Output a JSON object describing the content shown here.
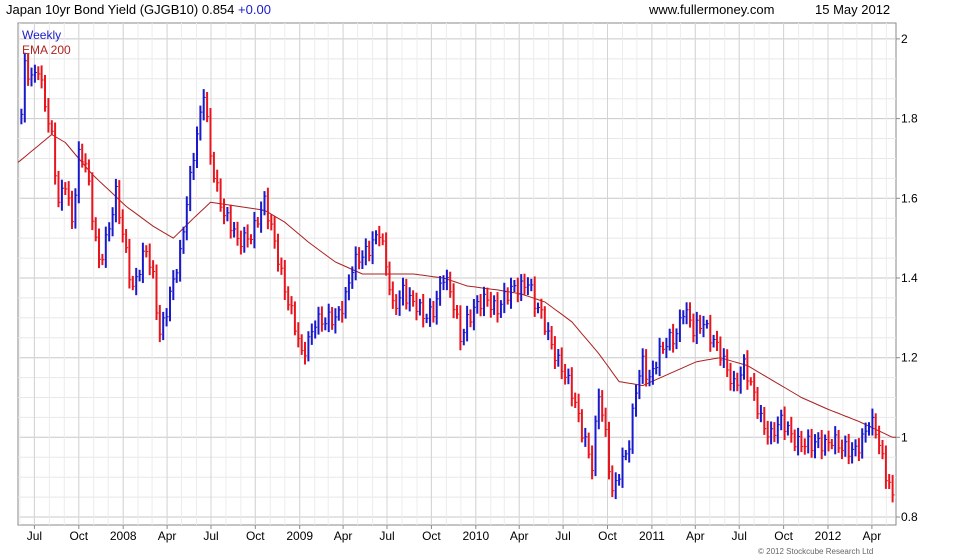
{
  "header": {
    "title": "Japan 10yr Bond Yield (GJGB10)",
    "last": "0.854",
    "change": "+0.00",
    "site": "www.fullermoney.com",
    "date": "15 May 2012"
  },
  "copyright": "© 2012 Stockcube Research Ltd",
  "colors": {
    "up": "#1a1acc",
    "down": "#e8141e",
    "ema": "#aa2020",
    "grid": "#cfcfcf",
    "axis": "#888888"
  },
  "chart_data": {
    "type": "line",
    "chart_style": "weekly high-low bars (blue up, red down) with EMA overlay",
    "grid": true,
    "legend_position": "top-left",
    "ylim": [
      0.78,
      2.04
    ],
    "y_ticks": [
      "0.8",
      "1",
      "1.2",
      "1.4",
      "1.6",
      "1.8",
      "2"
    ],
    "x_labels": [
      "Jul",
      "Oct",
      "2008",
      "Apr",
      "Jul",
      "Oct",
      "2009",
      "Apr",
      "Jul",
      "Oct",
      "2010",
      "Apr",
      "Jul",
      "Oct",
      "2011",
      "Apr",
      "Jul",
      "Oct",
      "2012",
      "Apr"
    ],
    "x_label_dates": [
      "2007-07-01",
      "2007-10-01",
      "2008-01-01",
      "2008-04-01",
      "2008-07-01",
      "2008-10-01",
      "2009-01-01",
      "2009-04-01",
      "2009-07-01",
      "2009-10-01",
      "2010-01-01",
      "2010-04-01",
      "2010-07-01",
      "2010-10-01",
      "2011-01-01",
      "2011-04-01",
      "2011-07-01",
      "2011-10-01",
      "2012-01-01",
      "2012-04-01"
    ],
    "x_range": [
      "2007-05-28",
      "2012-05-21"
    ],
    "series": [
      {
        "name": "Weekly",
        "anchors": [
          [
            "2007-06-04",
            1.8
          ],
          [
            "2007-06-11",
            1.92
          ],
          [
            "2007-06-25",
            1.9
          ],
          [
            "2007-07-09",
            1.94
          ],
          [
            "2007-07-23",
            1.84
          ],
          [
            "2007-08-06",
            1.74
          ],
          [
            "2007-08-20",
            1.58
          ],
          [
            "2007-09-03",
            1.65
          ],
          [
            "2007-09-17",
            1.55
          ],
          [
            "2007-10-01",
            1.7
          ],
          [
            "2007-10-15",
            1.68
          ],
          [
            "2007-10-29",
            1.56
          ],
          [
            "2007-11-12",
            1.45
          ],
          [
            "2007-12-03",
            1.52
          ],
          [
            "2007-12-17",
            1.6
          ],
          [
            "2008-01-07",
            1.47
          ],
          [
            "2008-01-21",
            1.38
          ],
          [
            "2008-02-04",
            1.42
          ],
          [
            "2008-02-18",
            1.46
          ],
          [
            "2008-03-03",
            1.4
          ],
          [
            "2008-03-17",
            1.27
          ],
          [
            "2008-04-07",
            1.35
          ],
          [
            "2008-04-28",
            1.45
          ],
          [
            "2008-05-12",
            1.6
          ],
          [
            "2008-05-26",
            1.72
          ],
          [
            "2008-06-09",
            1.8
          ],
          [
            "2008-06-16",
            1.86
          ],
          [
            "2008-06-30",
            1.7
          ],
          [
            "2008-07-14",
            1.63
          ],
          [
            "2008-07-28",
            1.57
          ],
          [
            "2008-08-11",
            1.53
          ],
          [
            "2008-08-25",
            1.48
          ],
          [
            "2008-09-08",
            1.5
          ],
          [
            "2008-09-22",
            1.52
          ],
          [
            "2008-10-06",
            1.55
          ],
          [
            "2008-10-20",
            1.58
          ],
          [
            "2008-11-03",
            1.52
          ],
          [
            "2008-11-17",
            1.46
          ],
          [
            "2008-12-01",
            1.38
          ],
          [
            "2008-12-22",
            1.27
          ],
          [
            "2009-01-05",
            1.2
          ],
          [
            "2009-01-19",
            1.25
          ],
          [
            "2009-02-02",
            1.3
          ],
          [
            "2009-02-23",
            1.28
          ],
          [
            "2009-03-16",
            1.3
          ],
          [
            "2009-04-06",
            1.36
          ],
          [
            "2009-04-20",
            1.42
          ],
          [
            "2009-05-11",
            1.45
          ],
          [
            "2009-06-01",
            1.5
          ],
          [
            "2009-06-15",
            1.52
          ],
          [
            "2009-06-29",
            1.42
          ],
          [
            "2009-07-13",
            1.32
          ],
          [
            "2009-08-03",
            1.38
          ],
          [
            "2009-08-24",
            1.33
          ],
          [
            "2009-09-14",
            1.3
          ],
          [
            "2009-10-05",
            1.33
          ],
          [
            "2009-10-26",
            1.4
          ],
          [
            "2009-11-16",
            1.33
          ],
          [
            "2009-11-30",
            1.26
          ],
          [
            "2009-12-14",
            1.3
          ],
          [
            "2010-01-04",
            1.32
          ],
          [
            "2010-01-25",
            1.35
          ],
          [
            "2010-02-15",
            1.33
          ],
          [
            "2010-03-08",
            1.35
          ],
          [
            "2010-03-29",
            1.38
          ],
          [
            "2010-04-19",
            1.4
          ],
          [
            "2010-05-03",
            1.33
          ],
          [
            "2010-05-24",
            1.28
          ],
          [
            "2010-06-14",
            1.22
          ],
          [
            "2010-07-05",
            1.15
          ],
          [
            "2010-07-26",
            1.08
          ],
          [
            "2010-08-16",
            1.0
          ],
          [
            "2010-08-30",
            0.93
          ],
          [
            "2010-09-13",
            1.1
          ],
          [
            "2010-09-27",
            1.0
          ],
          [
            "2010-10-11",
            0.87
          ],
          [
            "2010-10-25",
            0.92
          ],
          [
            "2010-11-15",
            0.97
          ],
          [
            "2010-11-29",
            1.12
          ],
          [
            "2010-12-13",
            1.2
          ],
          [
            "2010-12-27",
            1.15
          ],
          [
            "2011-01-17",
            1.2
          ],
          [
            "2011-02-07",
            1.25
          ],
          [
            "2011-02-21",
            1.27
          ],
          [
            "2011-03-07",
            1.32
          ],
          [
            "2011-03-28",
            1.26
          ],
          [
            "2011-04-18",
            1.3
          ],
          [
            "2011-05-09",
            1.24
          ],
          [
            "2011-05-30",
            1.18
          ],
          [
            "2011-06-20",
            1.14
          ],
          [
            "2011-07-11",
            1.18
          ],
          [
            "2011-07-25",
            1.12
          ],
          [
            "2011-08-15",
            1.05
          ],
          [
            "2011-09-05",
            1.01
          ],
          [
            "2011-09-26",
            1.03
          ],
          [
            "2011-10-17",
            1.01
          ],
          [
            "2011-11-07",
            0.99
          ],
          [
            "2011-11-28",
            0.97
          ],
          [
            "2011-12-19",
            0.99
          ],
          [
            "2012-01-09",
            1.0
          ],
          [
            "2012-01-30",
            0.96
          ],
          [
            "2012-02-20",
            0.97
          ],
          [
            "2012-03-12",
            1.0
          ],
          [
            "2012-03-26",
            1.03
          ],
          [
            "2012-04-09",
            1.01
          ],
          [
            "2012-04-23",
            0.95
          ],
          [
            "2012-05-07",
            0.89
          ],
          [
            "2012-05-14",
            0.855
          ]
        ]
      },
      {
        "name": "EMA 200",
        "anchors": [
          [
            "2007-05-28",
            1.69
          ],
          [
            "2007-08-06",
            1.76
          ],
          [
            "2007-09-03",
            1.74
          ],
          [
            "2007-10-29",
            1.66
          ],
          [
            "2008-01-07",
            1.58
          ],
          [
            "2008-03-03",
            1.53
          ],
          [
            "2008-04-14",
            1.5
          ],
          [
            "2008-05-26",
            1.55
          ],
          [
            "2008-06-30",
            1.59
          ],
          [
            "2008-08-25",
            1.58
          ],
          [
            "2008-10-20",
            1.57
          ],
          [
            "2008-12-01",
            1.54
          ],
          [
            "2009-01-19",
            1.49
          ],
          [
            "2009-03-16",
            1.44
          ],
          [
            "2009-05-11",
            1.41
          ],
          [
            "2009-06-29",
            1.41
          ],
          [
            "2009-08-24",
            1.41
          ],
          [
            "2009-10-26",
            1.4
          ],
          [
            "2009-12-14",
            1.38
          ],
          [
            "2010-02-15",
            1.37
          ],
          [
            "2010-04-05",
            1.36
          ],
          [
            "2010-05-24",
            1.34
          ],
          [
            "2010-07-19",
            1.29
          ],
          [
            "2010-09-13",
            1.21
          ],
          [
            "2010-10-25",
            1.14
          ],
          [
            "2010-12-13",
            1.13
          ],
          [
            "2011-02-07",
            1.16
          ],
          [
            "2011-04-04",
            1.19
          ],
          [
            "2011-05-23",
            1.2
          ],
          [
            "2011-07-18",
            1.18
          ],
          [
            "2011-09-12",
            1.14
          ],
          [
            "2011-11-07",
            1.1
          ],
          [
            "2012-01-02",
            1.07
          ],
          [
            "2012-03-05",
            1.04
          ],
          [
            "2012-05-14",
            1.0
          ]
        ]
      }
    ]
  }
}
